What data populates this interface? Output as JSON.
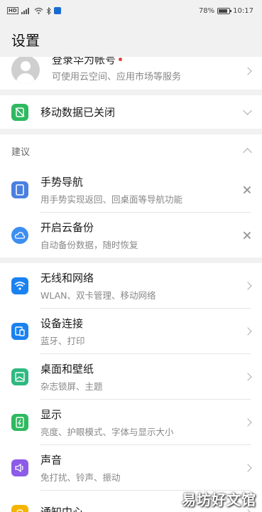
{
  "status_bar": {
    "battery": "78%",
    "time": "10:17",
    "hd": "HD",
    "signal": "4G",
    "battery_level": 0.78
  },
  "header": {
    "title": "设置"
  },
  "account": {
    "title": "登录华为帐号",
    "subtitle": "可使用云空间、应用市场等服务",
    "icon": "avatar-icon"
  },
  "mobile_data": {
    "label": "移动数据已关闭",
    "icon": "mobile-data-off-icon",
    "icon_color": "#2fb960"
  },
  "suggestions": {
    "header": "建议",
    "items": [
      {
        "title": "手势导航",
        "subtitle": "用手势实现返回、回桌面等导航功能",
        "icon": "phone-gesture-icon",
        "icon_color": "#4a7fe0"
      },
      {
        "title": "开启云备份",
        "subtitle": "自动备份数据，随时恢复",
        "icon": "cloud-backup-icon",
        "icon_color": "#3d8ef0"
      }
    ]
  },
  "settings": {
    "items": [
      {
        "title": "无线和网络",
        "subtitle": "WLAN、双卡管理、移动网络",
        "icon": "wifi-icon",
        "icon_color": "#1a82f0"
      },
      {
        "title": "设备连接",
        "subtitle": "蓝牙、打印",
        "icon": "device-connection-icon",
        "icon_color": "#1a82f0"
      },
      {
        "title": "桌面和壁纸",
        "subtitle": "杂志锁屏、主题",
        "icon": "wallpaper-icon",
        "icon_color": "#2fb980"
      },
      {
        "title": "显示",
        "subtitle": "亮度、护眼模式、字体与显示大小",
        "icon": "display-icon",
        "icon_color": "#2fb960"
      },
      {
        "title": "声音",
        "subtitle": "免打扰、铃声、振动",
        "icon": "sound-icon",
        "icon_color": "#8c5be8"
      },
      {
        "title": "通知中心",
        "subtitle": "",
        "icon": "notification-icon",
        "icon_color": "#f5b400"
      }
    ]
  },
  "watermark": "易坊好文馆"
}
